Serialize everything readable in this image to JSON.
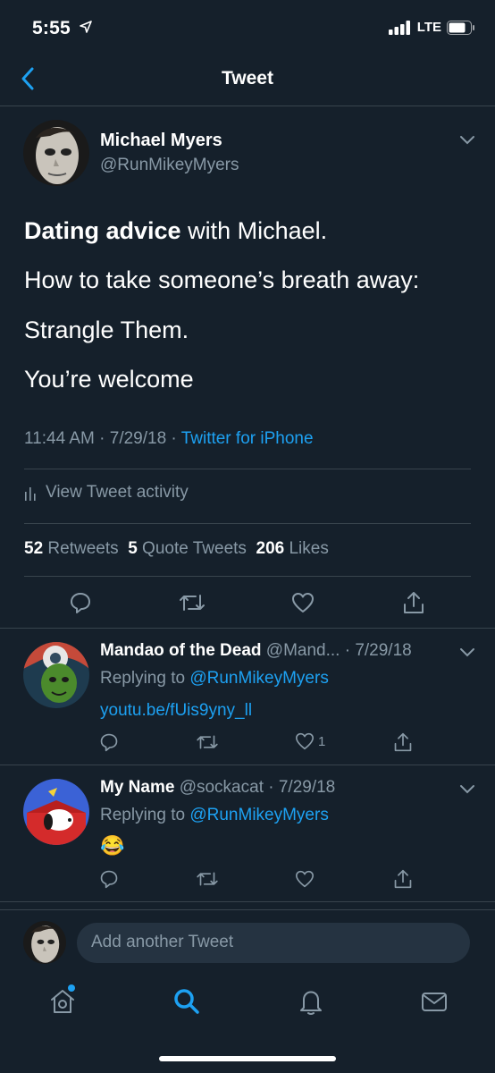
{
  "status_bar": {
    "time": "5:55",
    "network": "LTE"
  },
  "header": {
    "title": "Tweet"
  },
  "tweet": {
    "author_name": "Michael Myers",
    "author_handle": "@RunMikeyMyers",
    "line1_bold": "Dating advice",
    "line1_rest": " with Michael.",
    "line2": "How to take someone’s breath away:",
    "line3": "Strangle Them.",
    "line4": "You’re welcome",
    "time": "11:44 AM · 7/29/18 · ",
    "source": "Twitter for iPhone",
    "activity_label": "View Tweet activity",
    "retweets_count": "52",
    "retweets_label": "Retweets",
    "quotes_count": "5",
    "quotes_label": "Quote Tweets",
    "likes_count": "206",
    "likes_label": "Likes"
  },
  "replies": [
    {
      "name": "Mandao of the Dead",
      "handle_date": " @Mand... · 7/29/18",
      "replying_prefix": "Replying to ",
      "replying_to": "@RunMikeyMyers",
      "link": "youtu.be/fUis9yny_ll",
      "like_count": "1"
    },
    {
      "name": "My Name",
      "handle_date": " @sockacat · 7/29/18",
      "replying_prefix": "Replying to ",
      "replying_to": "@RunMikeyMyers",
      "emoji": "😂"
    }
  ],
  "compose": {
    "placeholder": "Add another Tweet"
  },
  "colors": {
    "background": "#15202b",
    "accent": "#1da1f2",
    "muted": "#8899a6",
    "divider": "#38444d"
  },
  "icons": [
    "location-arrow-icon",
    "signal-icon",
    "battery-icon",
    "back-icon",
    "chevron-down-icon",
    "reply-icon",
    "retweet-icon",
    "like-icon",
    "share-icon",
    "activity-icon",
    "home-icon",
    "search-icon",
    "notifications-icon",
    "messages-icon"
  ]
}
